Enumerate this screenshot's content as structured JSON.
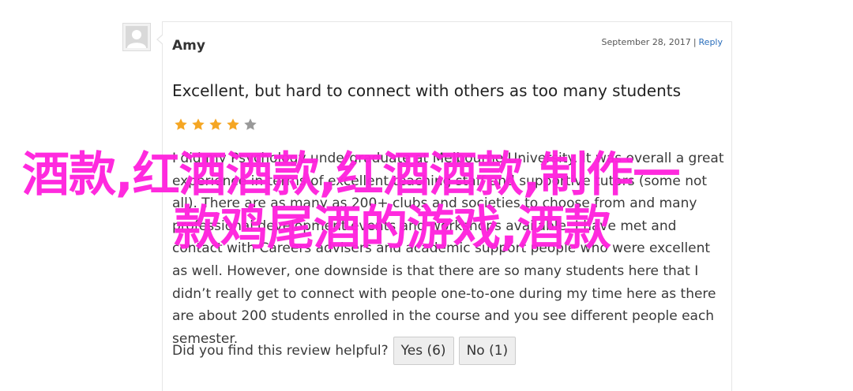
{
  "review": {
    "author": "Amy",
    "date": "September 28, 2017",
    "separator": "|",
    "reply_label": "Reply",
    "title": "Excellent, but hard to connect with others as too many students",
    "rating": 4,
    "rating_max": 5,
    "body": "I did my Psychology undergraduate at Melbourne University. It was overall a great experience in terms of excellent teaching staff and supportive tutors (some not all). There are as many as 200+ clubs and societies to choose from and many professional development events and workshops available. I have met and contact with Careers advisers and academic support people who were excellent as well. However, one downside is that there are so many students here that I didn’t really get to connect with people one-to-one during my time here as there are about 200 students enrolled in the course and you see different people each semester.",
    "helpful_prompt": "Did you find this review helpful?",
    "yes_label": "Yes (6)",
    "no_label": "No (1)"
  },
  "overlay": {
    "line1": "酒款,红酒酒款,红酒酒款,制作一",
    "line2": "款鸡尾酒的游戏,酒款"
  },
  "colors": {
    "star_filled": "#f5a623",
    "star_empty": "#999999",
    "link": "#2a6ebb",
    "overlay": "#ff22dd"
  }
}
